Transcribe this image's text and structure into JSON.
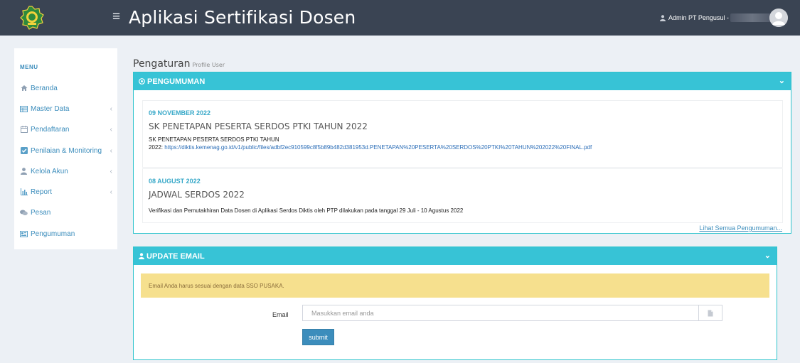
{
  "header": {
    "app_title": "Aplikasi Sertifikasi Dosen",
    "user_label": "Admin PT Pengusul -",
    "logo_icon": "kemenag-emblem-icon",
    "menu_icon": "hamburger-icon"
  },
  "sidebar": {
    "menu_label": "MENU",
    "items": [
      {
        "label": "Beranda",
        "icon": "home-icon"
      },
      {
        "label": "Master Data",
        "icon": "table-icon"
      },
      {
        "label": "Pendaftaran",
        "icon": "calendar-icon"
      },
      {
        "label": "Penilaian & Monitoring",
        "icon": "check-square-icon"
      },
      {
        "label": "Kelola Akun",
        "icon": "user-icon"
      },
      {
        "label": "Report",
        "icon": "bar-chart-icon"
      },
      {
        "label": "Pesan",
        "icon": "comments-icon"
      },
      {
        "label": "Pengumuman",
        "icon": "newspaper-icon"
      }
    ]
  },
  "page": {
    "title": "Pengaturan",
    "subtitle": "Profile User"
  },
  "announcements": {
    "header": "PENGUMUMAN",
    "items": [
      {
        "date": "09 NOVEMBER 2022",
        "title": "SK PENETAPAN PESERTA SERDOS PTKI TAHUN 2022",
        "body_line1": "SK PENETAPAN PESERTA SERDOS PTKI TAHUN",
        "body_prefix": "2022:",
        "link": "https://diktis.kemenag.go.id/v1/public/files/adbf2ec910599c8f5b89b482d381953d.PENETAPAN%20PESERTA%20SERDOS%20PTKI%20TAHUN%202022%20FINAL.pdf"
      },
      {
        "date": "08 AUGUST 2022",
        "title": "JADWAL SERDOS 2022",
        "body_line1": "Verifikasi dan Pemutakhiran Data Dosen di Aplikasi Serdos Diktis oleh PTP dilakukan pada tanggal 29 Juli - 10 Agustus 2022"
      }
    ],
    "see_all": "Lihat Semua Pengumuman..."
  },
  "update_email": {
    "header": "UPDATE EMAIL",
    "warning": "Email Anda harus sesuai dengan data SSO PUSAKA.",
    "label": "Email",
    "placeholder": "Masukkan email anda",
    "value": "",
    "submit": "submit"
  },
  "colors": {
    "topbar": "#3a4453",
    "box_header": "#37c3d6",
    "link": "#3c8dbc",
    "warning_bg": "#f6e08e",
    "date": "#37a8c8"
  }
}
